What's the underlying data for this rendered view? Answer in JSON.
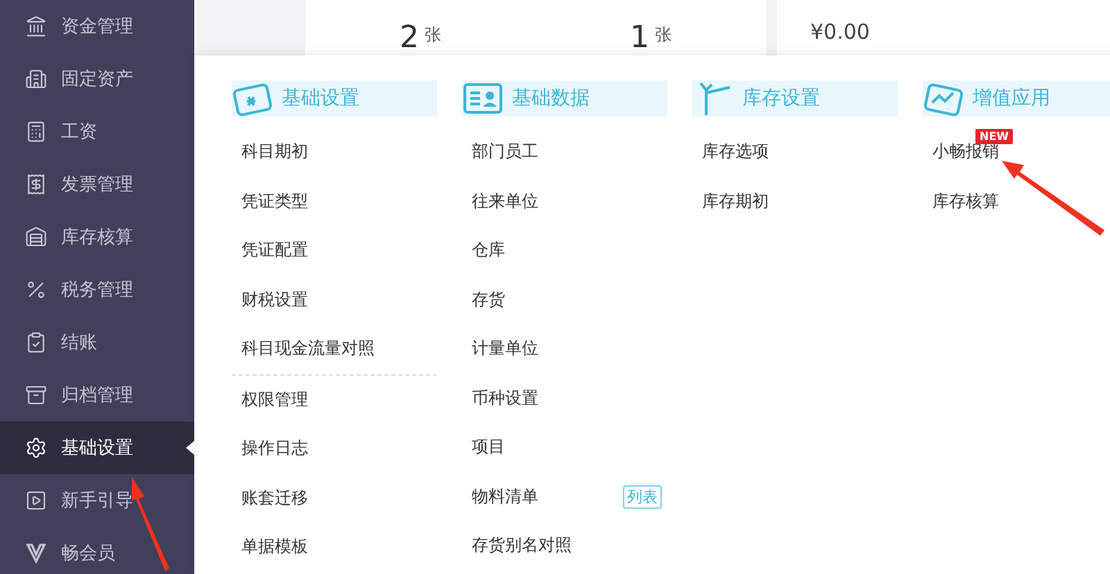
{
  "sidebar": {
    "items": [
      {
        "label": "资金管理",
        "selected": false
      },
      {
        "label": "固定资产",
        "selected": false
      },
      {
        "label": "工资",
        "selected": false
      },
      {
        "label": "发票管理",
        "selected": false
      },
      {
        "label": "库存核算",
        "selected": false
      },
      {
        "label": "税务管理",
        "selected": false
      },
      {
        "label": "结账",
        "selected": false
      },
      {
        "label": "归档管理",
        "selected": false
      },
      {
        "label": "基础设置",
        "selected": true
      },
      {
        "label": "新手引导",
        "selected": false
      },
      {
        "label": "畅会员",
        "selected": false
      }
    ]
  },
  "summary": {
    "cards": [
      {
        "value": "2",
        "unit": "张"
      },
      {
        "value": "1",
        "unit": "张"
      }
    ],
    "amount": "¥0.00"
  },
  "menu": {
    "columns": [
      {
        "title": "基础设置",
        "groups": [
          [
            {
              "label": "科目期初"
            },
            {
              "label": "凭证类型"
            },
            {
              "label": "凭证配置"
            },
            {
              "label": "财税设置"
            },
            {
              "label": "科目现金流量对照"
            }
          ],
          [
            {
              "label": "权限管理"
            },
            {
              "label": "操作日志"
            },
            {
              "label": "账套迁移"
            },
            {
              "label": "单据模板"
            }
          ]
        ]
      },
      {
        "title": "基础数据",
        "groups": [
          [
            {
              "label": "部门员工"
            },
            {
              "label": "往来单位"
            },
            {
              "label": "仓库"
            },
            {
              "label": "存货"
            },
            {
              "label": "计量单位"
            },
            {
              "label": "币种设置"
            },
            {
              "label": "项目"
            },
            {
              "label": "物料清单",
              "tag": "列表"
            },
            {
              "label": "存货别名对照"
            }
          ]
        ]
      },
      {
        "title": "库存设置",
        "groups": [
          [
            {
              "label": "库存选项"
            },
            {
              "label": "库存期初"
            }
          ]
        ]
      },
      {
        "title": "增值应用",
        "groups": [
          [
            {
              "label": "小畅报销",
              "badge": "NEW"
            },
            {
              "label": "库存核算"
            }
          ]
        ]
      }
    ]
  }
}
